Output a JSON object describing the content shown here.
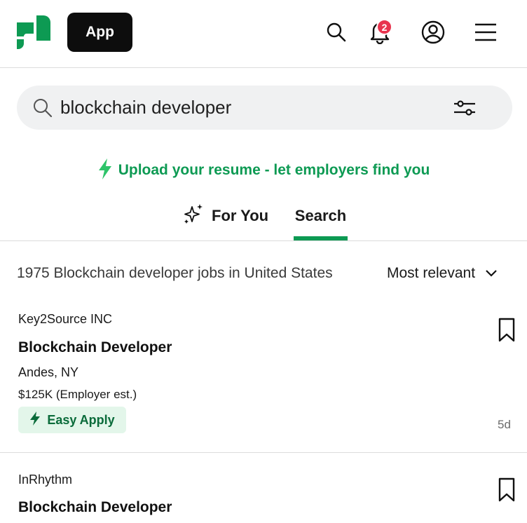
{
  "header": {
    "logo": "glassdoor-logo",
    "app_button": "App",
    "notification_count": "2",
    "brand_color": "#0d9a53"
  },
  "search": {
    "query": "blockchain developer",
    "placeholder": ""
  },
  "upload_banner": {
    "text": "Upload your resume - let employers find you",
    "icon": "lightning-icon"
  },
  "tabs": [
    {
      "label": "For You",
      "icon": "sparkle-icon",
      "active": false
    },
    {
      "label": "Search",
      "active": true
    }
  ],
  "results": {
    "count_text": "1975 Blockchain developer jobs in United States",
    "sort_label": "Most relevant"
  },
  "jobs": [
    {
      "company": "Key2Source INC",
      "title": "Blockchain Developer",
      "location": "Andes, NY",
      "salary": "$125K (Employer est.)",
      "easy_apply": "Easy Apply",
      "age": "5d"
    },
    {
      "company": "InRhythm",
      "title": "Blockchain Developer"
    }
  ]
}
